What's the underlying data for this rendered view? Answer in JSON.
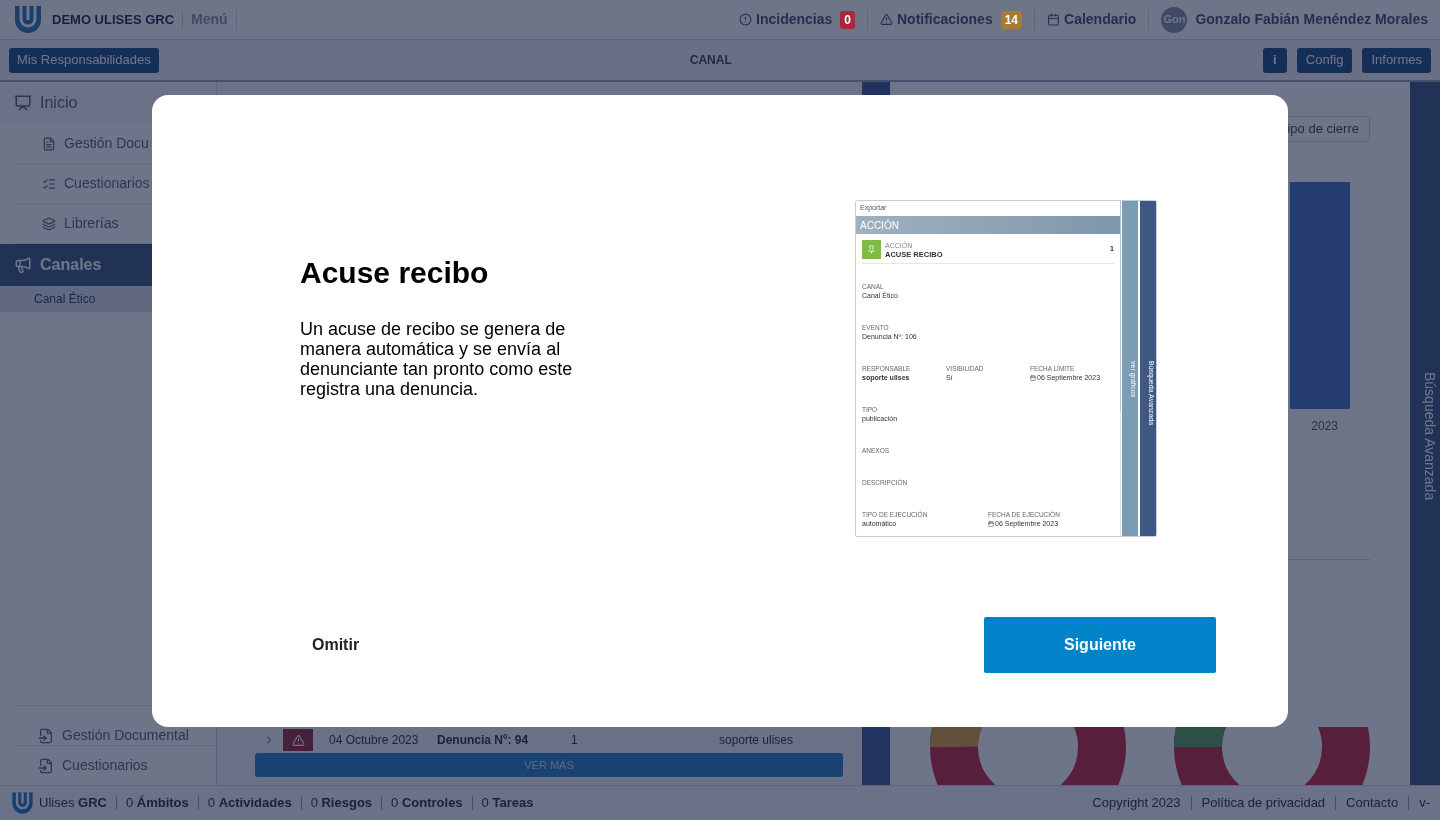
{
  "header": {
    "brand": "DEMO ULISES GRC",
    "menu": "Menú",
    "items": [
      {
        "kind": "incidents",
        "label": "Incidencias",
        "count": "0",
        "color": "#a8293f"
      },
      {
        "kind": "notifications",
        "label": "Notificaciones",
        "count": "14",
        "color": "#a87a34"
      },
      {
        "kind": "calendar",
        "label": "Calendario"
      }
    ],
    "user": {
      "avatar_text": "Gon",
      "name": "Gonzalo Fabián Menéndez Morales"
    }
  },
  "toolbar": {
    "left_button": "Mis Responsabilidades",
    "title": "CANAL",
    "info_button": "i",
    "buttons": [
      "Config",
      "Informes"
    ]
  },
  "sidebar": {
    "items": [
      {
        "kind": "home",
        "label": "Inicio",
        "selected": false,
        "children": [
          {
            "kind": "document",
            "label": "Gestión Docu"
          },
          {
            "kind": "list",
            "label": "Cuestionarios"
          },
          {
            "kind": "layers",
            "label": "Librerías"
          }
        ]
      },
      {
        "kind": "megaphone",
        "label": "Canales",
        "selected": true,
        "children": [
          {
            "kind": "none",
            "label": "Canal Ético"
          }
        ]
      }
    ],
    "bottom_items": [
      {
        "label": "Gestión Documental"
      },
      {
        "label": "Cuestionarios"
      }
    ]
  },
  "table": {
    "rows": [
      {
        "date": "04 Octubre 2023",
        "title": "Denuncia Nº: 94",
        "count": "1",
        "owner": "soporte ulises"
      }
    ],
    "more_button": "VER MÁS"
  },
  "right_panel": {
    "filter_button": "ipo de cierre",
    "bar_label": "2023",
    "side_tab": "Búsqueda Avanzada"
  },
  "footer": {
    "brand": "Ulises",
    "brand_bold": "GRC",
    "counters": [
      {
        "count": "0",
        "label": "Ámbitos"
      },
      {
        "count": "0",
        "label": "Actividades"
      },
      {
        "count": "0",
        "label": "Riesgos"
      },
      {
        "count": "0",
        "label": "Controles"
      },
      {
        "count": "0",
        "label": "Tareas"
      }
    ],
    "links": [
      "Copyright 2023",
      "Política de privacidad",
      "Contacto",
      "v-"
    ]
  },
  "modal": {
    "title": "Acuse recibo",
    "text": "Un acuse de recibo se genera de manera automática y se envía al denunciante tan pronto como este registra una denuncia.",
    "preview": {
      "export": "Exportar",
      "header": "ACCIÓN",
      "action": {
        "label": "ACCIÓN",
        "title": "ACUSE RECIBO",
        "number": "1"
      },
      "rows": [
        [
          {
            "label": "CANAL",
            "value": "Canal Ético"
          }
        ],
        [
          {
            "label": "EVENTO",
            "value": "Denuncia Nº: 106"
          }
        ],
        [
          {
            "label": "RESPONSABLE",
            "value": "soporte ulises",
            "kind": "bold"
          },
          {
            "label": "VISIBILIDAD",
            "value": "Sí",
            "kind": "text"
          },
          {
            "label": "FECHA LÍMITE",
            "value": "06 Septiembre 2023",
            "kind": "date"
          }
        ],
        [
          {
            "label": "TIPO",
            "value": "publicación"
          }
        ],
        [
          {
            "label": "ANEXOS"
          }
        ],
        [
          {
            "label": "DESCRIPCIÓN"
          }
        ],
        [
          {
            "label": "TIPO DE EJECUCIÓN",
            "value": "automático",
            "kind": "text"
          },
          {
            "label": "FECHA DE EJECUCIÓN",
            "value": "06 Septiembre 2023",
            "kind": "date"
          }
        ]
      ],
      "side_tabs": [
        "ver gráficos",
        "Búsqueda Avanzada"
      ]
    },
    "skip": "Omitir",
    "next": "Siguiente"
  }
}
